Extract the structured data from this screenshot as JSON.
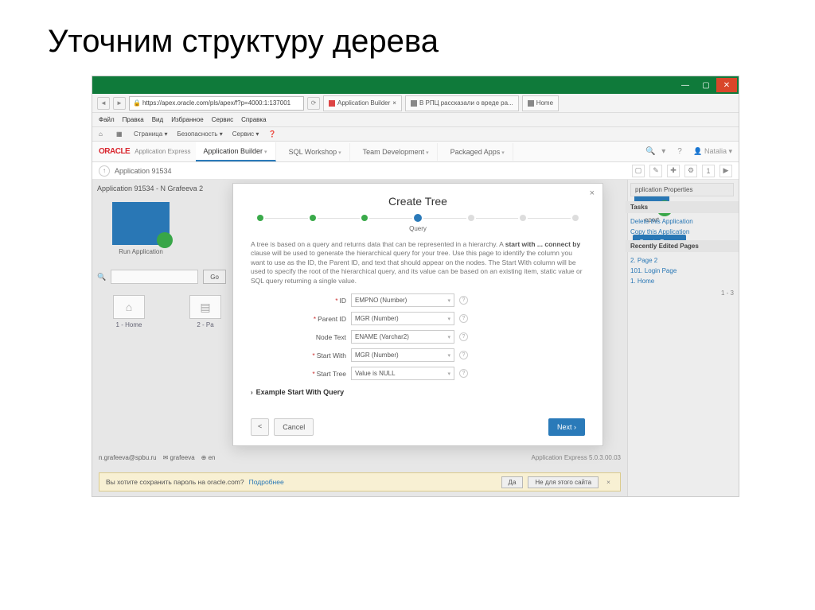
{
  "slide": {
    "title": "Уточним структуру дерева"
  },
  "window": {
    "min": "—",
    "max": "▢",
    "close": "✕"
  },
  "addr": {
    "back": "◄",
    "fwd": "►",
    "url": "https://apex.oracle.com/pls/apex/f?p=4000:1:137001",
    "refresh": "⟳",
    "tabs": [
      {
        "icon": "■",
        "label": "Application Builder",
        "close": "×"
      },
      {
        "icon": "■",
        "label": "В РПЦ рассказали о вреде ра...",
        "close": "×"
      },
      {
        "icon": "■",
        "label": "Home",
        "close": "×"
      }
    ]
  },
  "browser_menu": [
    "Файл",
    "Правка",
    "Вид",
    "Избранное",
    "Сервис",
    "Справка"
  ],
  "browser_menu2": [
    "Страница ▾",
    "Безопасность ▾",
    "Сервис ▾"
  ],
  "oracle": {
    "logo": "ORACLE",
    "label": "Application Express",
    "tabs": [
      "Application Builder",
      "SQL Workshop",
      "Team Development",
      "Packaged Apps"
    ],
    "user": "Natalia"
  },
  "crumb": {
    "up": "↑",
    "path": "Application 91534",
    "icons": [
      "▢",
      "✎",
      "✚",
      "⚙",
      "1",
      "▶"
    ]
  },
  "app": {
    "heading": "Application 91534 - N Grafeeva 2",
    "run_label": "Run Application",
    "search_go": "Go",
    "mini": [
      {
        "icon": "⌂",
        "label": "1 - Home"
      },
      {
        "icon": "▤",
        "label": "2 - Pa"
      }
    ],
    "footer_left": [
      "n.grafeeva@spbu.ru",
      "✉ grafeeva",
      "⊕ en"
    ],
    "footer_right": "Application Express 5.0.3.00.03"
  },
  "right": {
    "props_btn": "pplication Properties",
    "tasks_head": "Tasks",
    "tasks": [
      "Delete this Application",
      "Copy this Application"
    ],
    "recent_head": "Recently Edited Pages",
    "recent": [
      "2. Page 2",
      "101. Login Page",
      "1. Home"
    ],
    "create_page": "Create Page",
    "report_lbl": "eport",
    "paging": "1 - 3"
  },
  "modal": {
    "title": "Create Tree",
    "x": "×",
    "step_label": "Query",
    "desc1": "A tree is based on a query and returns data that can be represented in a hierarchy. A ",
    "desc_bold": "start with ... connect by",
    "desc2": " clause will be used to generate the hierarchical query for your tree. Use this page to identify the column you want to use as the ID, the Parent ID, and text that should appear on the nodes. The Start With column will be used to specify the root of the hierarchical query, and its value can be based on an existing item, static value or SQL query returning a single value.",
    "fields": [
      {
        "label": "ID",
        "value": "EMPNO (Number)",
        "req": true
      },
      {
        "label": "Parent ID",
        "value": "MGR (Number)",
        "req": true
      },
      {
        "label": "Node Text",
        "value": "ENAME (Varchar2)",
        "req": false
      },
      {
        "label": "Start With",
        "value": "MGR (Number)",
        "req": true
      },
      {
        "label": "Start Tree",
        "value": "Value is NULL",
        "req": true
      }
    ],
    "expand": "Example Start With Query",
    "back": "<",
    "cancel": "Cancel",
    "next": "Next"
  },
  "pwbar": {
    "text": "Вы хотите сохранить пароль на oracle.com?",
    "more": "Подробнее",
    "yes": "Да",
    "no": "Не для этого сайта",
    "x": "×"
  }
}
